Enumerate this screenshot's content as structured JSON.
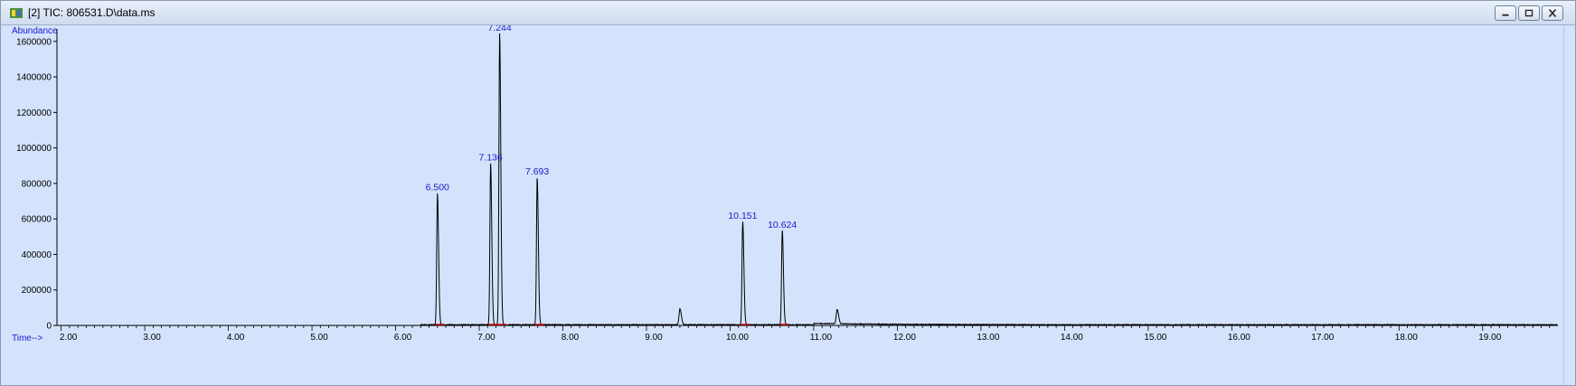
{
  "window": {
    "title": "[2] TIC: 806531.D\\data.ms",
    "buttons": [
      "minimize",
      "restore",
      "close"
    ],
    "colors": {
      "plot_bg": "#d4e3fb",
      "trace": "#000000",
      "label": "#1a1acc",
      "baseline_marks": "#cc0000"
    }
  },
  "chart_data": {
    "type": "line",
    "title": "",
    "ylabel": "Abundance",
    "xlabel": "Time-->",
    "xlim": [
      1.95,
      19.9
    ],
    "ylim": [
      0,
      1650000
    ],
    "x_ticks": [
      "2.00",
      "3.00",
      "4.00",
      "5.00",
      "6.00",
      "7.00",
      "8.00",
      "9.00",
      "10.00",
      "11.00",
      "12.00",
      "13.00",
      "14.00",
      "15.00",
      "16.00",
      "17.00",
      "18.00",
      "19.00"
    ],
    "y_ticks": [
      "0",
      "200000",
      "400000",
      "600000",
      "800000",
      "1000000",
      "1200000",
      "1400000",
      "1600000"
    ],
    "grid": false,
    "peaks": [
      {
        "rt": 6.5,
        "height": 740000,
        "label": "6.500"
      },
      {
        "rt": 7.136,
        "height": 910000,
        "label": "7.136"
      },
      {
        "rt": 7.244,
        "height": 1640000,
        "label": "7.244"
      },
      {
        "rt": 7.693,
        "height": 830000,
        "label": "7.693"
      },
      {
        "rt": 9.4,
        "height": 90000,
        "label": ""
      },
      {
        "rt": 10.151,
        "height": 580000,
        "label": "10.151"
      },
      {
        "rt": 10.624,
        "height": 530000,
        "label": "10.624"
      },
      {
        "rt": 11.28,
        "height": 80000,
        "label": ""
      }
    ]
  }
}
